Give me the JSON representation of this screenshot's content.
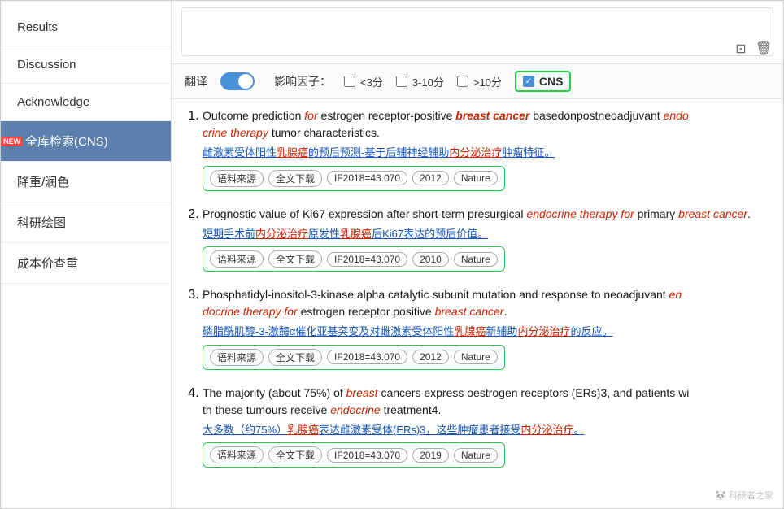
{
  "sidebar": {
    "items": [
      {
        "id": "results",
        "label": "Results",
        "active": false,
        "badge": false
      },
      {
        "id": "discussion",
        "label": "Discussion",
        "active": false,
        "badge": false
      },
      {
        "id": "acknowledge",
        "label": "Acknowledge",
        "active": false,
        "badge": false
      },
      {
        "id": "fullsearch",
        "label": "全库检索(CNS)",
        "active": true,
        "badge": true,
        "badge_text": "NEW"
      },
      {
        "id": "reduce",
        "label": "降重/润色",
        "active": false,
        "badge": false
      },
      {
        "id": "drawing",
        "label": "科研绘图",
        "active": false,
        "badge": false
      },
      {
        "id": "cost",
        "label": "成本价查重",
        "active": false,
        "badge": false
      }
    ]
  },
  "filter": {
    "translate_label": "翻译",
    "impact_label": "影响因子：",
    "option1_label": "<3分",
    "option2_label": "3-10分",
    "option3_label": ">10分",
    "cns_label": "CNS"
  },
  "icons": {
    "copy": "⊡",
    "delete": "🗑",
    "checkmark": "✓"
  },
  "results": [
    {
      "num": 1,
      "title_parts": [
        {
          "text": "Outcome prediction ",
          "style": "normal"
        },
        {
          "text": "for",
          "style": "italic-red"
        },
        {
          "text": " estrogen receptor-positive ",
          "style": "normal"
        },
        {
          "text": "breast cancer",
          "style": "bold-italic-red"
        },
        {
          "text": " basedonpostneoadjuvant ",
          "style": "normal"
        },
        {
          "text": "endo",
          "style": "italic-red"
        },
        {
          "text": "crine therapy",
          "style": "italic-red"
        },
        {
          "text": " tumor characteristics.",
          "style": "normal"
        }
      ],
      "translation": "雌激素受体阳性乳腺癌的预后预测-基于后辅神经辅助内分泌治疗肿瘤特征。",
      "tags": [
        "语料来源",
        "全文下载",
        "IF2018=43.070",
        "2012",
        "Nature"
      ]
    },
    {
      "num": 2,
      "title_parts": [
        {
          "text": "Prognostic value of Ki67 expression after short-term presurgical ",
          "style": "normal"
        },
        {
          "text": "endocrine therapy for",
          "style": "italic-red"
        },
        {
          "text": " primary ",
          "style": "normal"
        },
        {
          "text": "breast cancer",
          "style": "italic-red"
        },
        {
          "text": ".",
          "style": "normal"
        }
      ],
      "translation": "短期手术前内分泌治疗原发性乳腺癌后Ki67表达的预后价值。",
      "tags": [
        "语料来源",
        "全文下载",
        "IF2018=43.070",
        "2010",
        "Nature"
      ]
    },
    {
      "num": 3,
      "title_parts": [
        {
          "text": "Phosphatidyl-inositol-3-kinase alpha catalytic subunit mutation and response to neoadjuvant ",
          "style": "normal"
        },
        {
          "text": "en",
          "style": "italic-red"
        },
        {
          "text": "docrine therapy for",
          "style": "italic-red"
        },
        {
          "text": " estrogen receptor positive ",
          "style": "normal"
        },
        {
          "text": "breast cancer",
          "style": "italic-red"
        },
        {
          "text": ".",
          "style": "normal"
        }
      ],
      "translation": "磷脂酰肌醇-3-激酶α催化亚基突变及对雌激素受体阳性乳腺癌新辅助内分泌治疗的反应。",
      "tags": [
        "语料来源",
        "全文下载",
        "IF2018=43.070",
        "2012",
        "Nature"
      ]
    },
    {
      "num": 4,
      "title_parts": [
        {
          "text": "The majority (about 75%) of ",
          "style": "normal"
        },
        {
          "text": "breast",
          "style": "italic-red"
        },
        {
          "text": " cancers express oestrogen receptors (ERs)3, and patients with these tumours receive ",
          "style": "normal"
        },
        {
          "text": "endocrine",
          "style": "italic-red"
        },
        {
          "text": " treatment4.",
          "style": "normal"
        }
      ],
      "translation": "大多数（约75%）乳腺癌表达雌激素受体(ERs)3，这些肿瘤患者接受内分泌治疗。",
      "tags": [
        "语料来源",
        "全文下载",
        "IF2018=43.070",
        "2019",
        "Nature"
      ]
    }
  ],
  "watermark": "科研者之家"
}
